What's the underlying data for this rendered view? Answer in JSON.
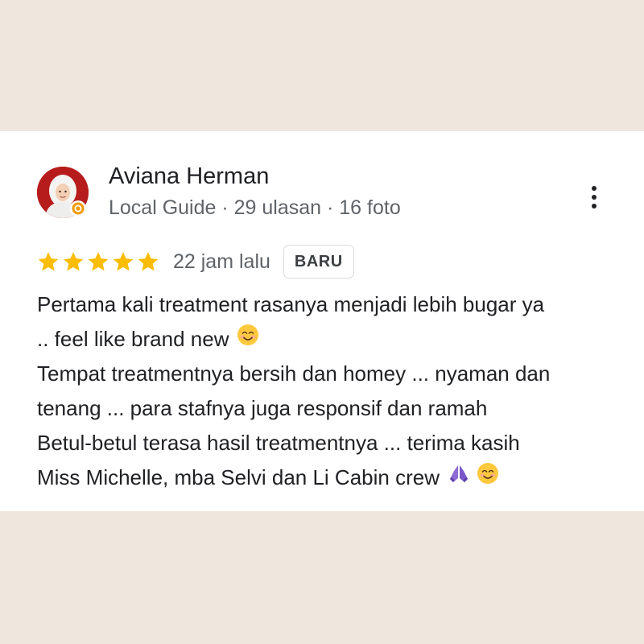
{
  "review": {
    "reviewer": {
      "name": "Aviana Herman",
      "meta": "Local Guide · 29 ulasan · 16 foto",
      "avatar_icon": "profile-photo",
      "badge_icon": "local-guide-badge"
    },
    "rating": {
      "stars": 5,
      "max": 5,
      "color": "#fbbc04"
    },
    "time": "22 jam lalu",
    "badge": "BARU",
    "menu_icon": "more-vert-icon",
    "text_lines": [
      "Pertama kali treatment rasanya menjadi lebih bugar ya",
      ".. feel like brand new",
      "Tempat treatmentnya bersih dan homey ... nyaman dan",
      "tenang ... para stafnya juga responsif dan ramah",
      "Betul-betul terasa hasil treatmentnya ... terima kasih",
      "Miss Michelle, mba Selvi dan Li Cabin crew"
    ],
    "emojis": {
      "line_2": "smiling-face-icon",
      "line_6": [
        "folded-hands-icon",
        "smiling-face-icon"
      ]
    }
  },
  "colors": {
    "background": "#efe6dd",
    "card": "#ffffff",
    "text": "#202124",
    "secondary_text": "#5f6368",
    "avatar_background": "#b71c1c"
  }
}
